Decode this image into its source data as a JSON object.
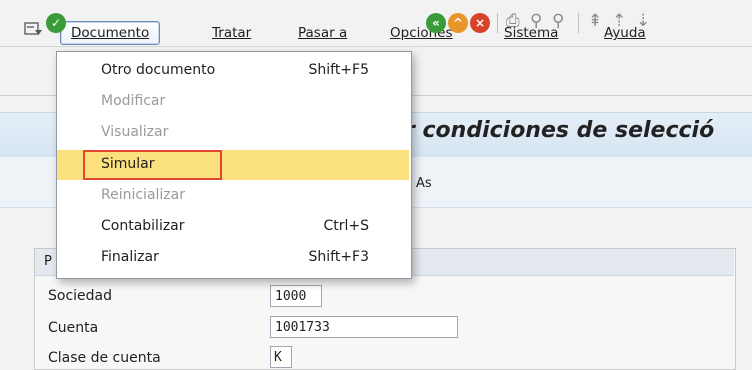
{
  "menubar": {
    "items": [
      {
        "label": "Documento"
      },
      {
        "label": "Tratar"
      },
      {
        "label": "Pasar a"
      },
      {
        "label": "Opciones"
      },
      {
        "label": "Sistema"
      },
      {
        "label": "Ayuda"
      }
    ]
  },
  "page": {
    "title": "r condiciones de selecció",
    "subbar_text": "As"
  },
  "group": {
    "header_letter": "P"
  },
  "fields": [
    {
      "label": "Sociedad",
      "value": "1000"
    },
    {
      "label": "Cuenta",
      "value": "1001733"
    },
    {
      "label": "Clase de cuenta",
      "value": "K"
    }
  ],
  "dropdown": {
    "items": [
      {
        "label": "Otro documento",
        "shortcut": "Shift+F5",
        "enabled": true
      },
      {
        "label": "Modificar",
        "shortcut": "",
        "enabled": false
      },
      {
        "label": "Visualizar",
        "shortcut": "",
        "enabled": false
      },
      {
        "label": "Simular",
        "shortcut": "",
        "enabled": true
      },
      {
        "label": "Reinicializar",
        "shortcut": "",
        "enabled": false
      },
      {
        "label": "Contabilizar",
        "shortcut": "Ctrl+S",
        "enabled": true
      },
      {
        "label": "Finalizar",
        "shortcut": "Shift+F3",
        "enabled": true
      }
    ]
  },
  "colors": {
    "highlight": "#fbe07e",
    "annotation_border": "#e0482f"
  }
}
